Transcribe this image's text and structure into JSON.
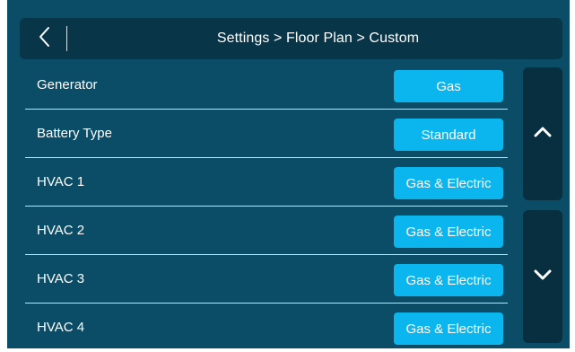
{
  "header": {
    "title": "Settings > Floor Plan > Custom",
    "back_icon": "chevron-left-icon"
  },
  "settings": [
    {
      "label": "Generator",
      "value": "Gas"
    },
    {
      "label": "Battery Type",
      "value": "Standard"
    },
    {
      "label": "HVAC 1",
      "value": "Gas & Electric"
    },
    {
      "label": "HVAC 2",
      "value": "Gas & Electric"
    },
    {
      "label": "HVAC 3",
      "value": "Gas & Electric"
    },
    {
      "label": "HVAC 4",
      "value": "Gas & Electric"
    }
  ],
  "scroll": {
    "up_icon": "chevron-up-icon",
    "down_icon": "chevron-down-icon"
  },
  "colors": {
    "panel_bg": "#0b4d66",
    "header_bg": "#083648",
    "button_accent": "#0bb6ee",
    "scroll_bg": "#082f40"
  }
}
